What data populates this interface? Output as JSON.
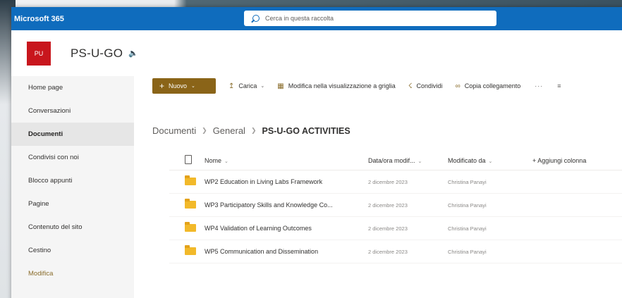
{
  "suite": {
    "app_name": "Microsoft 365",
    "search_placeholder": "Cerca in questa raccolta"
  },
  "site": {
    "logo_text": "PU",
    "title": "PS-U-GO"
  },
  "nav": {
    "items": [
      {
        "label": "Home page"
      },
      {
        "label": "Conversazioni"
      },
      {
        "label": "Documenti"
      },
      {
        "label": "Condivisi con noi"
      },
      {
        "label": "Blocco appunti"
      },
      {
        "label": "Pagine"
      },
      {
        "label": "Contenuto del sito"
      },
      {
        "label": "Cestino"
      },
      {
        "label": "Modifica"
      }
    ],
    "selected": "Documenti"
  },
  "commands": {
    "new_label": "Nuovo",
    "upload_label": "Carica",
    "grid_edit_label": "Modifica nella visualizzazione a griglia",
    "share_label": "Condividi",
    "copy_link_label": "Copia collegamento",
    "more_label": "···"
  },
  "breadcrumb": {
    "items": [
      "Documenti",
      "General"
    ],
    "current": "PS-U-GO ACTIVITIES"
  },
  "table": {
    "columns": {
      "name": "Nome",
      "modified": "Data/ora modif...",
      "modified_by": "Modificato da",
      "add_column": "Aggiungi colonna"
    },
    "rows": [
      {
        "name": "WP2 Education in Living Labs Framework",
        "modified": "2 dicembre 2023",
        "modified_by": "Christina Panayi"
      },
      {
        "name": "WP3 Participatory Skills and Knowledge Co...",
        "modified": "2 dicembre 2023",
        "modified_by": "Christina Panayi"
      },
      {
        "name": "WP4 Validation of Learning Outcomes",
        "modified": "2 dicembre 2023",
        "modified_by": "Christina Panayi"
      },
      {
        "name": "WP5 Communication and Dissemination",
        "modified": "2 dicembre 2023",
        "modified_by": "Christina Panayi"
      }
    ]
  },
  "colors": {
    "suite_bar": "#0f6cbd",
    "accent": "#8a6418",
    "logo": "#c8161d",
    "folder": "#f2b92a"
  }
}
